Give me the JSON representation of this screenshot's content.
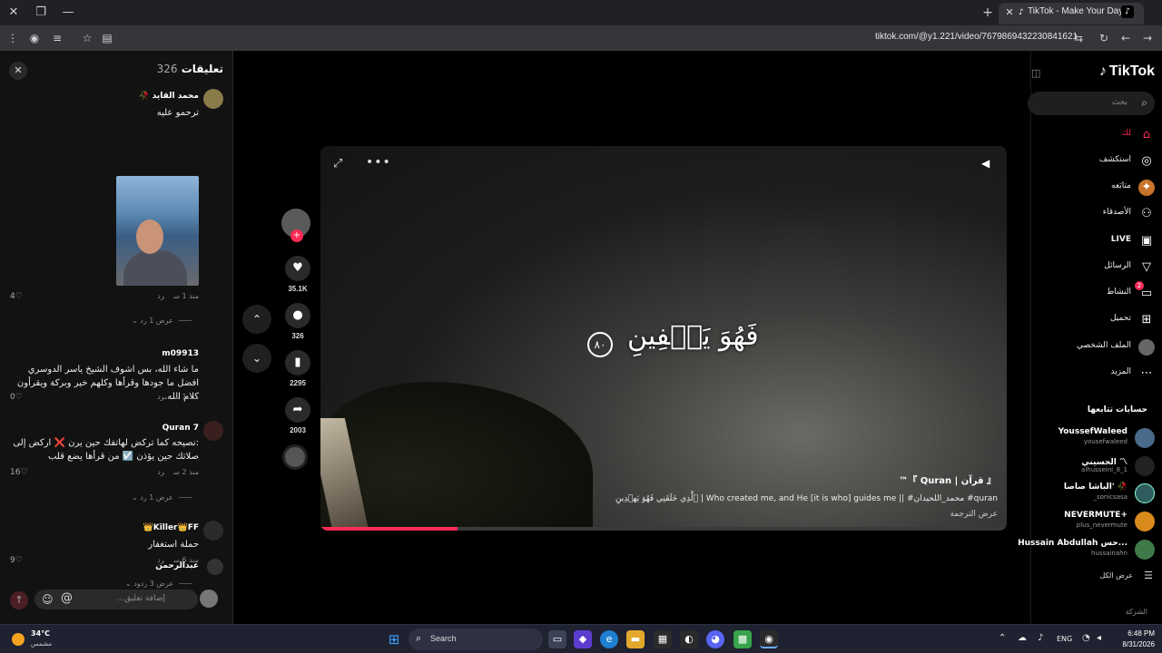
{
  "browser": {
    "tab_title": "TikTok - Make Your Day",
    "url": "tiktok.com/@y1.221/video/7679869432230841621"
  },
  "comments": {
    "title": "تعليقات",
    "count": "326",
    "items": [
      {
        "user": "محمد القايد 🥀",
        "text": "ترحمو عليه",
        "time": "منذ 1 س",
        "reply": "رد",
        "likes": "4",
        "more": "عرض 1 رد"
      },
      {
        "user": "m09913",
        "text": "ما شاء الله، بس اشوف الشيخ ياسر الدوسري افضل ما جودها وقرأها وكلهم خير وبركة ويقرأون كلام الله..",
        "time": "منذ 1 س",
        "reply": "رد",
        "likes": "0"
      },
      {
        "user": "Quran 7",
        "text": ":نصيحه كما تركض لهاتفك حين يرن ❌ اركض إلى صلاتك حين يؤذن ☑️ من قرأها يضع قلب",
        "time": "منذ 2 س",
        "reply": "رد",
        "likes": "16",
        "more": "عرض 1 رد"
      },
      {
        "user": "Killer👑FF👑",
        "text": "حملة استغفار",
        "time": "منذ 6 س",
        "reply": "رد",
        "likes": "9",
        "more": "عرض 3 ردود"
      },
      {
        "user": "عبدالرحمن"
      }
    ],
    "input_placeholder": "إضافة تعليق..."
  },
  "video": {
    "calligraphy": "فَهُوَ يَشۡفِينِ",
    "verse_number": "٨٠",
    "author_line": "『 قرآن | Quran 』™",
    "caption": "ٱلَّذِي خَلَقَنِي فَهُوَ يَهۡدِينِ | Who created me, and He [it is who] guides me || #محمد_اللحيدان #quran",
    "translate": "عرض الترجمة",
    "progress": 0.2
  },
  "actions": {
    "likes": "35.1K",
    "comments": "326",
    "saves": "2295",
    "shares": "2003"
  },
  "sidebar": {
    "brand": "TikTok",
    "search_placeholder": "بحث",
    "nav": [
      {
        "label": "لك",
        "icon": "home-icon"
      },
      {
        "label": "استكشف",
        "icon": "compass-icon"
      },
      {
        "label": "متابَعه",
        "icon": "following-icon"
      },
      {
        "label": "الأصدقاء",
        "icon": "friends-icon"
      },
      {
        "label": "LIVE",
        "icon": "live-icon"
      },
      {
        "label": "الرسائل",
        "icon": "messages-icon"
      },
      {
        "label": "النشاط",
        "icon": "activity-icon",
        "badge": "2"
      },
      {
        "label": "تحميل",
        "icon": "upload-icon"
      },
      {
        "label": "الملف الشخصي",
        "icon": "profile-icon"
      },
      {
        "label": "المزيد",
        "icon": "more-icon"
      }
    ],
    "following_title": "حسابات تتابعها",
    "accounts": [
      {
        "name": "YoussefWaleed",
        "handle": "yousefwaleed"
      },
      {
        "name": "الحسيني 〽",
        "handle": "alhusseini_8_1"
      },
      {
        "name": "الباشا صاصا' 🥀",
        "handle": "_sonicsasa"
      },
      {
        "name": "NEVERMUTE+",
        "handle": "plus_nevermute"
      },
      {
        "name": "Hussain Abdullah حس...",
        "handle": "hussainahn"
      }
    ],
    "see_all": "عرض الكل",
    "company": "الشركة"
  },
  "taskbar": {
    "temp": "34°C",
    "weather": "مشمس",
    "search": "Search",
    "lang": "ENG",
    "time": "6:48 PM",
    "date": "8/31/2026"
  }
}
